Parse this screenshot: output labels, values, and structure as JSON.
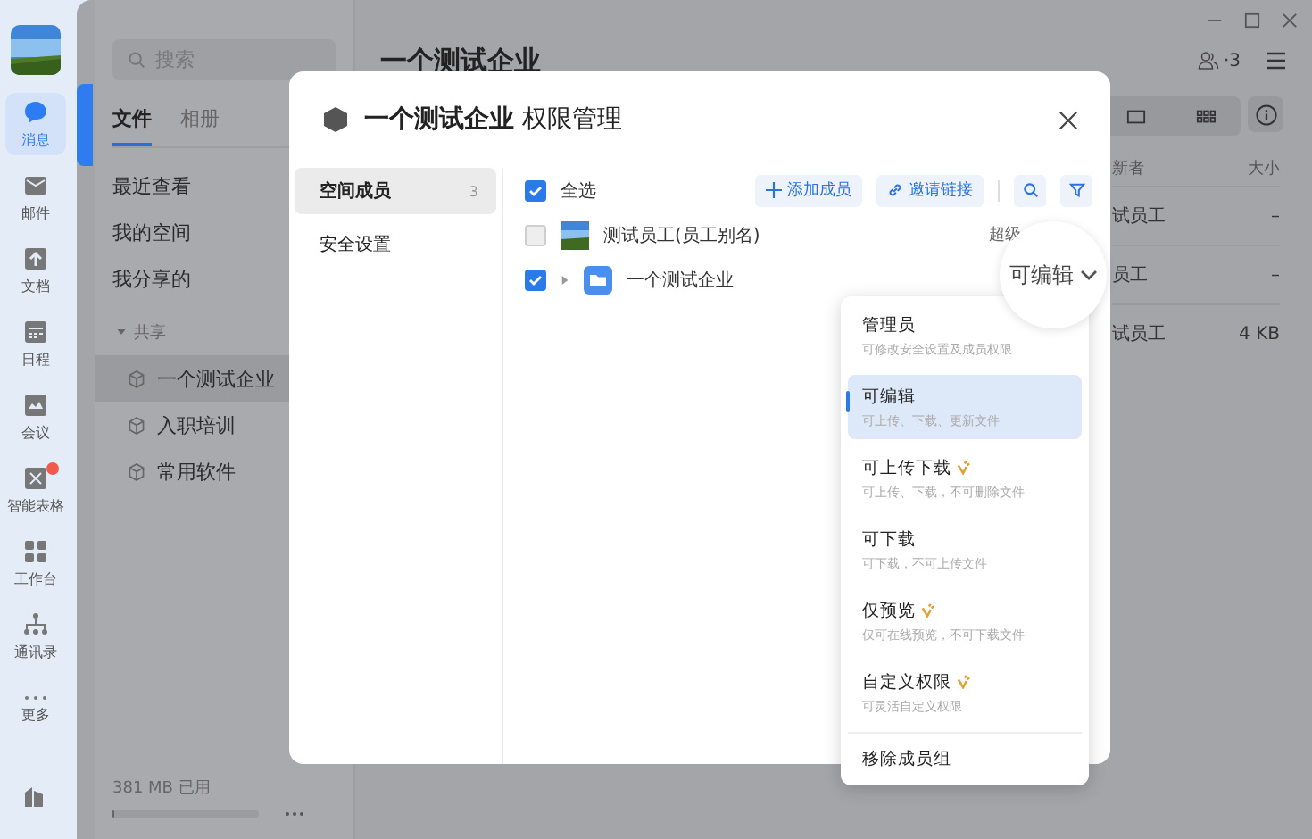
{
  "rail": {
    "items": [
      {
        "label": "消息",
        "selected": true,
        "badge": false
      },
      {
        "label": "邮件",
        "selected": false,
        "badge": false
      },
      {
        "label": "文档",
        "selected": false,
        "badge": false
      },
      {
        "label": "日程",
        "selected": false,
        "badge": false
      },
      {
        "label": "会议",
        "selected": false,
        "badge": false
      },
      {
        "label": "智能表格",
        "selected": false,
        "badge": true
      },
      {
        "label": "工作台",
        "selected": false,
        "badge": false
      },
      {
        "label": "通讯录",
        "selected": false,
        "badge": false
      },
      {
        "label": "更多",
        "selected": false,
        "badge": false
      }
    ]
  },
  "sidebar": {
    "search": {
      "placeholder": "搜索"
    },
    "tabs": [
      {
        "label": "文件",
        "selected": true
      },
      {
        "label": "相册",
        "selected": false
      }
    ],
    "nav": [
      {
        "label": "最近查看"
      },
      {
        "label": "我的空间"
      },
      {
        "label": "我分享的"
      }
    ],
    "shared": {
      "label": "共享",
      "expanded": true,
      "children": [
        {
          "label": "一个测试企业",
          "selected": true
        },
        {
          "label": "入职培训",
          "selected": false
        },
        {
          "label": "常用软件",
          "selected": false
        }
      ]
    },
    "storage": {
      "text": "381 MB 已用",
      "level": 0.01
    }
  },
  "main": {
    "title": "一个测试企业",
    "members": "·3",
    "table": {
      "columns": [
        "新者",
        "大小"
      ],
      "rows": [
        {
          "cells": [
            "试员工",
            "–"
          ]
        },
        {
          "cells": [
            "员工",
            "–"
          ]
        },
        {
          "cells": [
            "试员工",
            "4 KB"
          ]
        }
      ]
    }
  },
  "modal": {
    "title": "一个测试企业",
    "subtitle": "权限管理",
    "nav": [
      {
        "label": "空间成员",
        "count": "3",
        "selected": true
      },
      {
        "label": "安全设置",
        "selected": false
      }
    ],
    "select_all": {
      "label": "全选",
      "checked": true
    },
    "actions": [
      "添加成员",
      "邀请链接"
    ],
    "members": [
      {
        "kind": "person",
        "name": "测试员工(员工别名)",
        "checked": false,
        "role": "超级"
      },
      {
        "kind": "group",
        "name": "一个测试企业",
        "checked": true,
        "expanded": false
      }
    ]
  },
  "dropdown": {
    "options": [
      {
        "title": "管理员",
        "desc": "可修改安全设置及成员权限",
        "selected": false,
        "vip": false
      },
      {
        "title": "可编辑",
        "desc": "可上传、下载、更新文件",
        "selected": true,
        "vip": false
      },
      {
        "title": "可上传下载",
        "desc": "可上传、下载，不可删除文件",
        "selected": false,
        "vip": true
      },
      {
        "title": "可下载",
        "desc": "可下载，不可上传文件",
        "selected": false,
        "vip": false
      },
      {
        "title": "仅预览",
        "desc": "仅可在线预览，不可下载文件",
        "selected": false,
        "vip": true
      },
      {
        "title": "自定义权限",
        "desc": "可灵活自定义权限",
        "selected": false,
        "vip": true
      }
    ],
    "remove": "移除成员组"
  },
  "magnifier": {
    "value": "可编辑"
  }
}
